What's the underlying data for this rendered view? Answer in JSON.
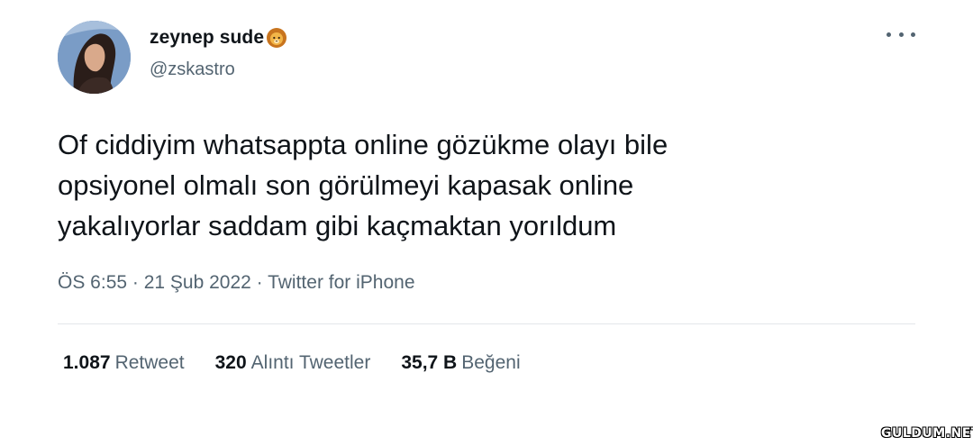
{
  "user": {
    "display_name": "zeynep sude",
    "handle": "@zskastro",
    "name_emoji_icon": "lion-face-icon"
  },
  "tweet": {
    "lines": [
      "Of ciddiyim whatsappta online gözükme olayı bile",
      "opsiyonel olmalı son görülmeyi kapasak online",
      "yakalıyorlar saddam gibi kaçmaktan yorıldum"
    ],
    "meta": "ÖS 6:55 · 21 Şub 2022 · Twitter for iPhone"
  },
  "stats": {
    "retweets": {
      "count": "1.087",
      "label": "Retweet"
    },
    "quotes": {
      "count": "320",
      "label": "Alıntı Tweetler"
    },
    "likes": {
      "count": "35,7 B",
      "label": "Beğeni"
    }
  },
  "watermark": "GULDUM.NET",
  "colors": {
    "text": "#0f1419",
    "secondary": "#536471",
    "divider": "#e3e7ea"
  }
}
